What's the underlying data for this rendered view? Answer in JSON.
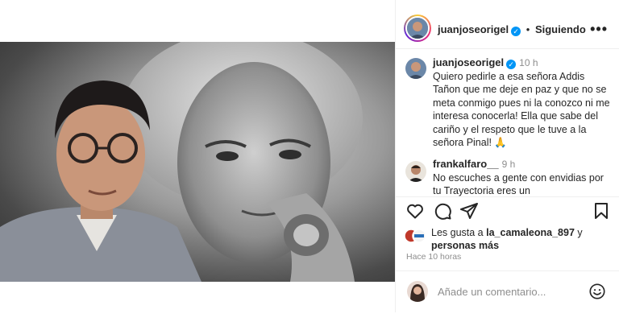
{
  "post": {
    "author": "juanjoseorigel",
    "follow_separator": "•",
    "follow_label": "Siguiendo",
    "more_icon": "more-horizontal-icon"
  },
  "caption": {
    "user": "juanjoseorigel",
    "time": "10 h",
    "text": "Quiero pedirle a esa señora Addis Tañon que me deje en paz y que no se meta conmigo pues ni la conozco ni me interesa conocerla! Ella que sabe del cariño y el respeto que le tuve a la señora Pinal! 🙏"
  },
  "comments": [
    {
      "user": "frankalfaro__",
      "time": "9 h",
      "text": "No escuches a gente con envidias por tu Trayectoria eres un"
    }
  ],
  "actions": {
    "like_icon": "heart-icon",
    "comment_icon": "comment-icon",
    "share_icon": "share-icon",
    "save_icon": "bookmark-icon"
  },
  "likes": {
    "prefix": "Les gusta a ",
    "user": "la_camaleona_897",
    "middle": " y",
    "others": "personas más"
  },
  "timestamp": "Hace 10 horas",
  "add_comment": {
    "placeholder": "Añade un comentario...",
    "emoji_icon": "emoji-icon"
  },
  "colors": {
    "accent": "#0095f6",
    "text": "#262626",
    "muted": "#8e8e8e",
    "divider": "#efefef"
  }
}
